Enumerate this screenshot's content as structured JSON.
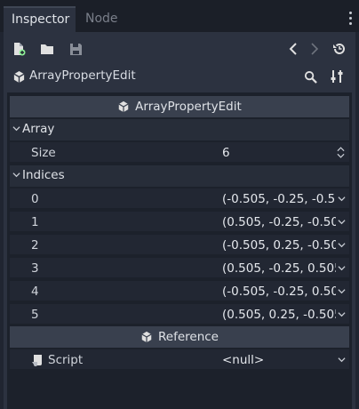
{
  "tabs": [
    {
      "label": "Inspector",
      "active": true
    },
    {
      "label": "Node",
      "active": false
    }
  ],
  "toolbar": {
    "icons": [
      "new-resource-icon",
      "open-folder-icon",
      "save-icon"
    ],
    "history_icons": [
      "back-icon",
      "forward-icon",
      "history-icon"
    ]
  },
  "object": {
    "name": "ArrayPropertyEdit",
    "tool_icons": [
      "search-icon",
      "tools-icon"
    ]
  },
  "sections": {
    "main": "ArrayPropertyEdit",
    "reference": "Reference"
  },
  "categories": {
    "array": "Array",
    "indices": "Indices"
  },
  "size": {
    "label": "Size",
    "value": "6"
  },
  "indices": [
    {
      "label": "0",
      "value": "(-0.505, -0.25, -0.5"
    },
    {
      "label": "1",
      "value": "(0.505, -0.25, -0.50"
    },
    {
      "label": "2",
      "value": "(-0.505, 0.25, -0.50"
    },
    {
      "label": "3",
      "value": "(0.505, -0.25, 0.505"
    },
    {
      "label": "4",
      "value": "(-0.505, -0.25, 0.50"
    },
    {
      "label": "5",
      "value": "(0.505, 0.25, -0.505"
    }
  ],
  "script": {
    "label": "Script",
    "value": "<null>"
  },
  "colors": {
    "background": "#202531",
    "panel": "#2c3240",
    "section_header": "#39404e",
    "accent_green": "#8eef97"
  }
}
